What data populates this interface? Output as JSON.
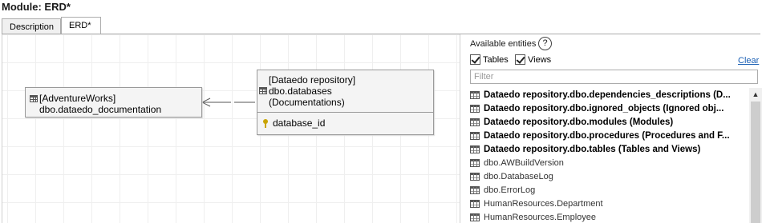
{
  "module": {
    "title": "Module: ERD*"
  },
  "tabs": [
    {
      "label": "Description",
      "active": false
    },
    {
      "label": "ERD*",
      "active": true
    }
  ],
  "erd": {
    "entity_left": {
      "line1": "[AdventureWorks]",
      "line2": "dbo.dataedo_documentation"
    },
    "entity_right": {
      "line1": "[Dataedo repository]",
      "line2": "dbo.databases",
      "line3": "(Documentations)",
      "column": "database_id"
    }
  },
  "panel": {
    "available_label": "Available entities",
    "help_glyph": "?",
    "tables_label": "Tables",
    "views_label": "Views",
    "tables_checked": true,
    "views_checked": true,
    "clear_label": "Clear",
    "filter_placeholder": "Filter",
    "items": [
      {
        "label": "Dataedo repository.dbo.dependencies_descriptions (D...",
        "bold": true
      },
      {
        "label": "Dataedo repository.dbo.ignored_objects (Ignored obj...",
        "bold": true
      },
      {
        "label": "Dataedo repository.dbo.modules (Modules)",
        "bold": true
      },
      {
        "label": "Dataedo repository.dbo.procedures (Procedures and F...",
        "bold": true
      },
      {
        "label": "Dataedo repository.dbo.tables (Tables and Views)",
        "bold": true
      },
      {
        "label": "dbo.AWBuildVersion",
        "bold": false
      },
      {
        "label": "dbo.DatabaseLog",
        "bold": false
      },
      {
        "label": "dbo.ErrorLog",
        "bold": false
      },
      {
        "label": "HumanResources.Department",
        "bold": false
      },
      {
        "label": "HumanResources.Employee",
        "bold": false
      }
    ]
  },
  "colors": {
    "link": "#1a5fb4",
    "key_icon": "#c9a400"
  }
}
